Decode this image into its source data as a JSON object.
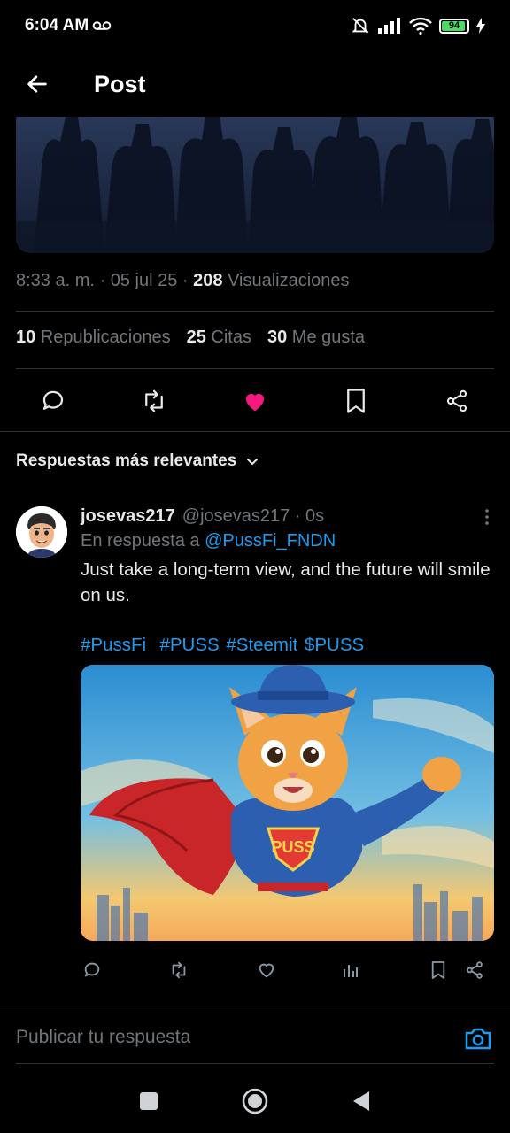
{
  "status_bar": {
    "time": "6:04 AM",
    "battery": "94"
  },
  "app_bar": {
    "title": "Post"
  },
  "post": {
    "time": "8:33 a. m.",
    "date": "05 jul 25",
    "views_count": "208",
    "views_label": "Visualizaciones",
    "reposts_count": "10",
    "reposts_label": "Republicaciones",
    "quotes_count": "25",
    "quotes_label": "Citas",
    "likes_count": "30",
    "likes_label": "Me gusta",
    "liked": true
  },
  "replies_sort": {
    "label": "Respuestas más relevantes"
  },
  "reply": {
    "display_name": "josevas217",
    "handle": "@josevas217",
    "time": "0s",
    "replying_prefix": "En respuesta a",
    "replying_to": "@PussFi_FNDN",
    "text": "Just take a long-term view, and the future will smile on us.",
    "hashtags": "#PussFi  #PUSS #Steemit $PUSS",
    "image_text": "PUSS"
  },
  "compose": {
    "placeholder": "Publicar tu respuesta"
  },
  "colors": {
    "accent": "#1d9bf0",
    "like": "#f91880",
    "background": "#000000",
    "muted": "#71767b"
  }
}
